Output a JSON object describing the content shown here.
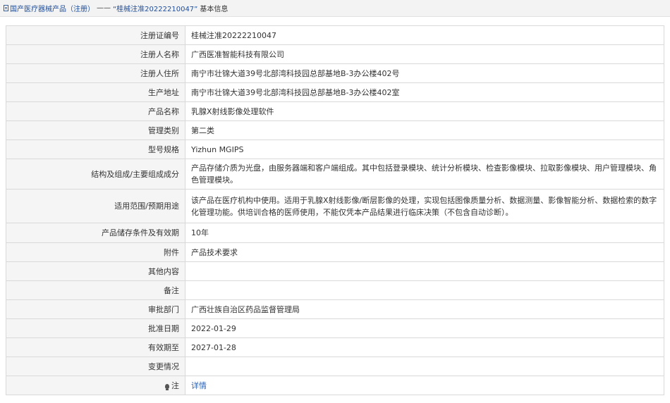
{
  "breadcrumb": {
    "category": "国产医疗器械产品（注册）",
    "separator": "——",
    "item": "“桂械注准20222210047”",
    "suffix": "基本信息"
  },
  "rows": [
    {
      "label": "注册证编号",
      "value": "桂械注准20222210047"
    },
    {
      "label": "注册人名称",
      "value": "广西医准智能科技有限公司"
    },
    {
      "label": "注册人住所",
      "value": "南宁市壮锦大道39号北部湾科技园总部基地B-3办公楼402号"
    },
    {
      "label": "生产地址",
      "value": "南宁市壮锦大道39号北部湾科技园总部基地B-3办公楼402室"
    },
    {
      "label": "产品名称",
      "value": "乳腺X射线影像处理软件"
    },
    {
      "label": "管理类别",
      "value": "第二类"
    },
    {
      "label": "型号规格",
      "value": "Yizhun MGIPS"
    },
    {
      "label": "结构及组成/主要组成成分",
      "value": "产品存储介质为光盘，由服务器端和客户端组成。其中包括登录模块、统计分析模块、检查影像模块、拉取影像模块、用户管理模块、角色管理模块。"
    },
    {
      "label": "适用范围/预期用途",
      "value": "该产品在医疗机构中使用。适用于乳腺X射线影像/断层影像的处理，实现包括图像质量分析、数据测量、影像智能分析、数据检索的数字化管理功能。供培训合格的医师使用，不能仅凭本产品结果进行临床决策（不包含自动诊断）。"
    },
    {
      "label": "产品储存条件及有效期",
      "value": "10年"
    },
    {
      "label": "附件",
      "value": "产品技术要求"
    },
    {
      "label": "其他内容",
      "value": ""
    },
    {
      "label": "备注",
      "value": ""
    },
    {
      "label": "审批部门",
      "value": "广西壮族自治区药品监督管理局"
    },
    {
      "label": "批准日期",
      "value": "2022-01-29"
    },
    {
      "label": "有效期至",
      "value": "2027-01-28"
    },
    {
      "label": "变更情况",
      "value": ""
    },
    {
      "label": "注",
      "value": "详情"
    }
  ]
}
